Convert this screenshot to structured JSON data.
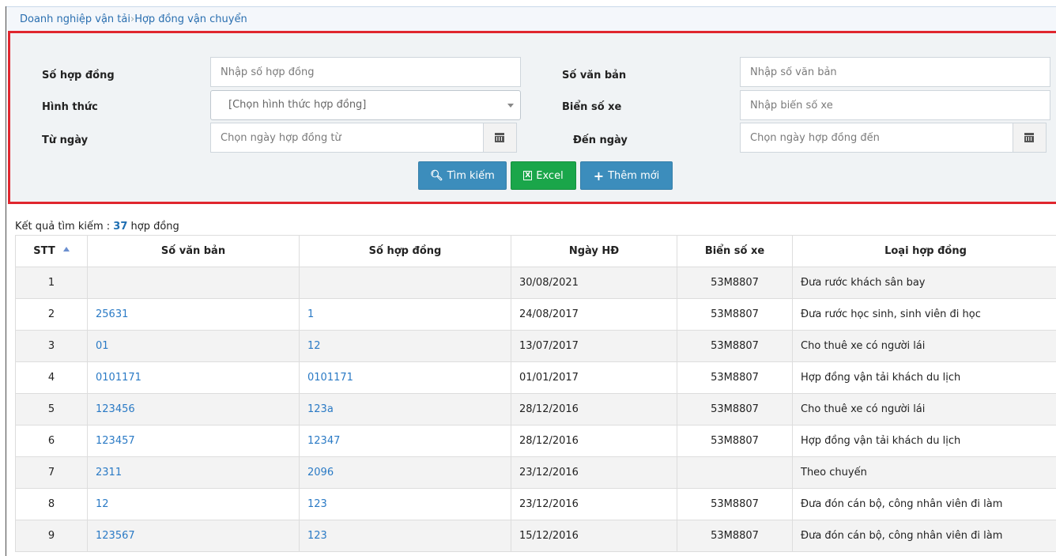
{
  "breadcrumb": {
    "root": "Doanh nghiệp vận tải",
    "separator": "›",
    "current": "Hợp đồng vận chuyển"
  },
  "filters": {
    "contract_no_label": "Số hợp đồng",
    "contract_no_placeholder": "Nhập số hợp đồng",
    "doc_no_label": "Số văn bản",
    "doc_no_placeholder": "Nhập số văn bản",
    "form_label": "Hình thức",
    "form_value": "[Chọn hình thức hợp đồng]",
    "plate_label": "Biển số xe",
    "plate_placeholder": "Nhập biển số xe",
    "from_label": "Từ ngày",
    "from_placeholder": "Chọn ngày hợp đồng từ",
    "to_label": "Đến ngày",
    "to_placeholder": "Chọn ngày hợp đồng đến"
  },
  "buttons": {
    "search": "Tìm kiếm",
    "excel": "Excel",
    "add": "Thêm mới"
  },
  "result": {
    "prefix": "Kết quả tìm kiếm : ",
    "count": "37",
    "suffix": " hợp đồng"
  },
  "table": {
    "columns": [
      "STT",
      "Số văn bản",
      "Số hợp đồng",
      "Ngày HĐ",
      "Biển số xe",
      "Loại hợp đồng"
    ],
    "rows": [
      {
        "stt": "1",
        "doc": "",
        "contract": "",
        "date": "30/08/2021",
        "plate": "53M8807",
        "type": "Đưa rước khách sân bay"
      },
      {
        "stt": "2",
        "doc": "25631",
        "contract": "1",
        "date": "24/08/2017",
        "plate": "53M8807",
        "type": "Đưa rước học sinh, sinh viên đi học"
      },
      {
        "stt": "3",
        "doc": "01",
        "contract": "12",
        "date": "13/07/2017",
        "plate": "53M8807",
        "type": "Cho thuê xe có người lái"
      },
      {
        "stt": "4",
        "doc": "0101171",
        "contract": "0101171",
        "date": "01/01/2017",
        "plate": "53M8807",
        "type": "Hợp đồng vận tải khách du lịch"
      },
      {
        "stt": "5",
        "doc": "123456",
        "contract": "123a",
        "date": "28/12/2016",
        "plate": "53M8807",
        "type": "Cho thuê xe có người lái"
      },
      {
        "stt": "6",
        "doc": "123457",
        "contract": "12347",
        "date": "28/12/2016",
        "plate": "53M8807",
        "type": "Hợp đồng vận tải khách du lịch"
      },
      {
        "stt": "7",
        "doc": "2311",
        "contract": "2096",
        "date": "23/12/2016",
        "plate": "",
        "type": "Theo chuyến"
      },
      {
        "stt": "8",
        "doc": "12",
        "contract": "123",
        "date": "23/12/2016",
        "plate": "53M8807",
        "type": "Đưa đón cán bộ, công nhân viên đi làm"
      },
      {
        "stt": "9",
        "doc": "123567",
        "contract": "123",
        "date": "15/12/2016",
        "plate": "53M8807",
        "type": "Đưa đón cán bộ, công nhân viên đi làm"
      }
    ]
  },
  "colors": {
    "link": "#2a7ac5",
    "primary": "#3c8dbc",
    "excel": "#1aa64a",
    "highlight_border": "#e0262e"
  },
  "icons": {
    "search": "search-icon",
    "excel": "excel-file-icon",
    "add": "plus-icon",
    "calendar": "calendar-icon",
    "sort": "sort-asc-icon"
  }
}
